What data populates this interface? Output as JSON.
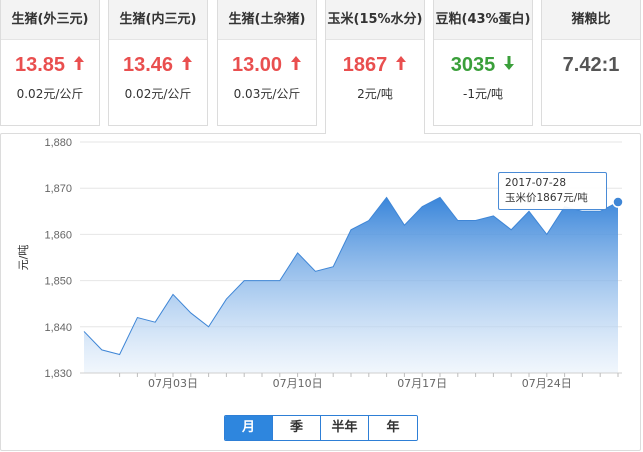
{
  "cards": [
    {
      "title": "生猪(外三元)",
      "value": "13.85",
      "trend": "up",
      "change": "0.02元/公斤"
    },
    {
      "title": "生猪(内三元)",
      "value": "13.46",
      "trend": "up",
      "change": "0.02元/公斤"
    },
    {
      "title": "生猪(土杂猪)",
      "value": "13.00",
      "trend": "up",
      "change": "0.03元/公斤"
    },
    {
      "title": "玉米(15%水分)",
      "value": "1867",
      "trend": "up",
      "change": "2元/吨",
      "active": true
    },
    {
      "title": "豆粕(43%蛋白)",
      "value": "3035",
      "trend": "down",
      "change": "-1元/吨"
    },
    {
      "title": "猪粮比",
      "value": "7.42:1",
      "trend": "none",
      "change": ""
    }
  ],
  "colors": {
    "up": "#e94f4f",
    "down": "#3a9f3a",
    "line": "#3f86d6",
    "fill_top": "#2f7fd8",
    "fill_bottom": "#e6f0fb"
  },
  "icons": {
    "up": "arrow-up-icon",
    "down": "arrow-down-icon"
  },
  "tooltip": {
    "date": "2017-07-28",
    "text": "玉米价1867元/吨"
  },
  "range_buttons": [
    {
      "label": "月",
      "selected": true
    },
    {
      "label": "季",
      "selected": false
    },
    {
      "label": "半年",
      "selected": false
    },
    {
      "label": "年",
      "selected": false
    }
  ],
  "chart_data": {
    "type": "area",
    "ylabel": "元/吨",
    "xlabel": "",
    "ylim": [
      1830,
      1880
    ],
    "yticks": [
      1830,
      1840,
      1850,
      1860,
      1870,
      1880
    ],
    "ytick_labels": [
      "1,830",
      "1,840",
      "1,850",
      "1,860",
      "1,870",
      "1,880"
    ],
    "xtick_labels": [
      "07月03日",
      "07月10日",
      "07月17日",
      "07月24日"
    ],
    "xtick_dates": [
      "2017-06-30",
      "2017-07-01",
      "2017-07-02",
      "2017-07-03",
      "2017-07-04",
      "2017-07-05",
      "2017-07-06",
      "2017-07-07",
      "2017-07-08",
      "2017-07-09",
      "2017-07-10",
      "2017-07-11",
      "2017-07-12",
      "2017-07-13",
      "2017-07-14",
      "2017-07-15",
      "2017-07-16",
      "2017-07-17",
      "2017-07-18",
      "2017-07-19",
      "2017-07-20",
      "2017-07-21",
      "2017-07-22",
      "2017-07-23",
      "2017-07-24",
      "2017-07-25",
      "2017-07-26",
      "2017-07-27",
      "2017-07-28"
    ],
    "series": [
      {
        "name": "玉米价",
        "x": [
          "2017-06-28",
          "2017-06-29",
          "2017-06-30",
          "2017-07-01",
          "2017-07-02",
          "2017-07-03",
          "2017-07-04",
          "2017-07-05",
          "2017-07-06",
          "2017-07-07",
          "2017-07-08",
          "2017-07-09",
          "2017-07-10",
          "2017-07-11",
          "2017-07-12",
          "2017-07-13",
          "2017-07-14",
          "2017-07-15",
          "2017-07-16",
          "2017-07-17",
          "2017-07-18",
          "2017-07-19",
          "2017-07-20",
          "2017-07-21",
          "2017-07-22",
          "2017-07-23",
          "2017-07-24",
          "2017-07-25",
          "2017-07-26",
          "2017-07-27",
          "2017-07-28"
        ],
        "values": [
          1839,
          1835,
          1834,
          1842,
          1841,
          1847,
          1843,
          1840,
          1846,
          1850,
          1850,
          1850,
          1856,
          1852,
          1853,
          1861,
          1863,
          1868,
          1862,
          1866,
          1868,
          1863,
          1863,
          1864,
          1861,
          1865,
          1860,
          1866,
          1865,
          1865,
          1867
        ]
      }
    ],
    "highlight_index": 30,
    "grid": true
  }
}
